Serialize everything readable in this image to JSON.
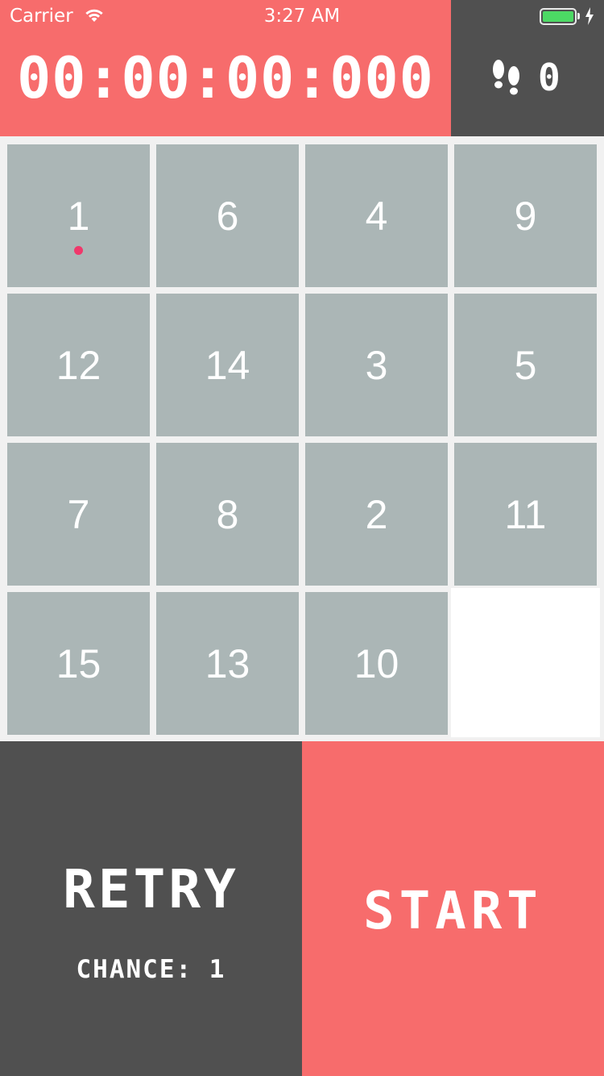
{
  "status_bar": {
    "carrier": "Carrier",
    "time": "3:27 AM",
    "battery_color": "#4cd964"
  },
  "header": {
    "timer": "00:00:00:000",
    "steps_icon": "footprints-icon",
    "steps": "0",
    "colors": {
      "timer_bg": "#f76c6c",
      "steps_bg": "#505050"
    }
  },
  "board": {
    "tiles": [
      {
        "label": "1",
        "marked": true
      },
      {
        "label": "6"
      },
      {
        "label": "4"
      },
      {
        "label": "9"
      },
      {
        "label": "12"
      },
      {
        "label": "14"
      },
      {
        "label": "3"
      },
      {
        "label": "5"
      },
      {
        "label": "7"
      },
      {
        "label": "8"
      },
      {
        "label": "2"
      },
      {
        "label": "11"
      },
      {
        "label": "15"
      },
      {
        "label": "13"
      },
      {
        "label": "10"
      },
      {
        "label": "",
        "empty": true
      }
    ],
    "colors": {
      "tile": "#abb6b6",
      "empty": "#ffffff",
      "marker": "#f0386b"
    }
  },
  "controls": {
    "retry_label": "RETRY",
    "chance_label": "CHANCE: 1",
    "start_label": "START"
  }
}
